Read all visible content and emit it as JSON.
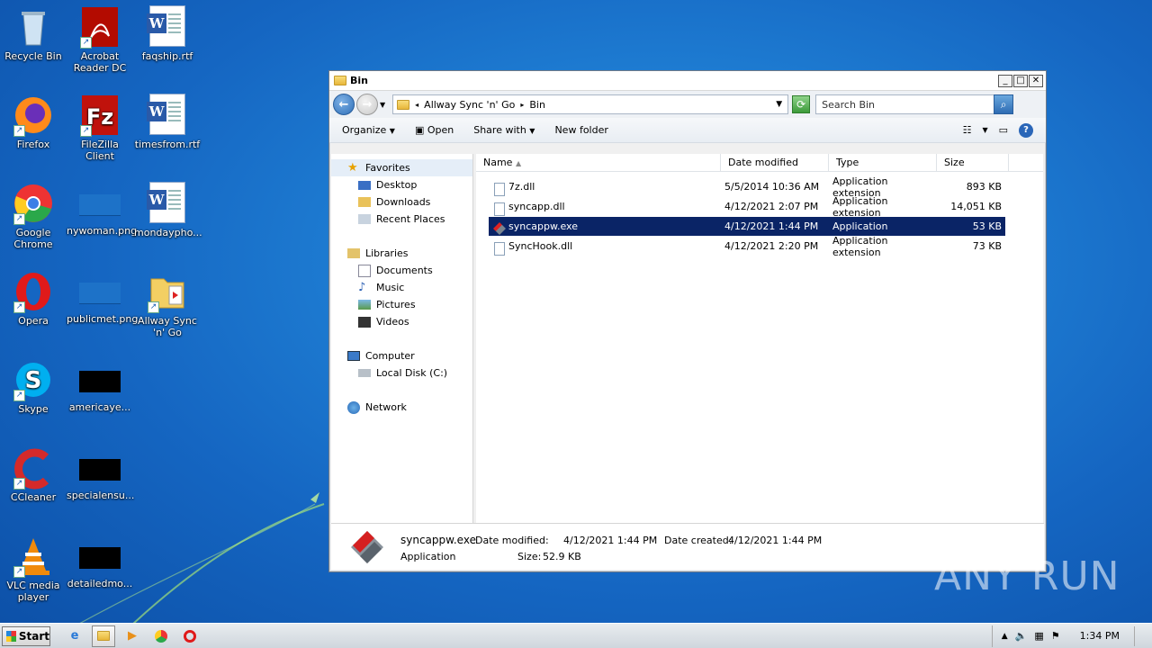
{
  "desktop": {
    "icons": [
      {
        "label": "Recycle Bin",
        "icon": "recycle-bin-icon"
      },
      {
        "label": "Acrobat Reader DC",
        "icon": "acrobat-icon"
      },
      {
        "label": "faqship.rtf",
        "icon": "word-document-icon"
      },
      {
        "label": "Firefox",
        "icon": "firefox-icon"
      },
      {
        "label": "FileZilla Client",
        "icon": "filezilla-icon"
      },
      {
        "label": "timesfrom.rtf",
        "icon": "word-document-icon"
      },
      {
        "label": "Google Chrome",
        "icon": "chrome-icon"
      },
      {
        "label": "nywoman.png",
        "icon": "image-thumbnail"
      },
      {
        "label": "mondaypho...",
        "icon": "word-document-icon"
      },
      {
        "label": "Opera",
        "icon": "opera-icon"
      },
      {
        "label": "publicmet.png",
        "icon": "image-thumbnail"
      },
      {
        "label": "Allway Sync 'n' Go",
        "icon": "allway-sync-icon"
      },
      {
        "label": "Skype",
        "icon": "skype-icon"
      },
      {
        "label": "americaye...",
        "icon": "black-thumbnail"
      },
      {
        "label": "CCleaner",
        "icon": "ccleaner-icon"
      },
      {
        "label": "specialensu...",
        "icon": "black-thumbnail"
      },
      {
        "label": "VLC media player",
        "icon": "vlc-icon"
      },
      {
        "label": "detailedmo...",
        "icon": "black-thumbnail"
      }
    ]
  },
  "window": {
    "title": "Bin",
    "breadcrumb": [
      "Allway Sync 'n' Go",
      "Bin"
    ],
    "search_placeholder": "Search Bin",
    "toolbar": {
      "organize": "Organize",
      "open": "Open",
      "share_with": "Share with",
      "new_folder": "New folder"
    },
    "nav": {
      "favorites": "Favorites",
      "desktop": "Desktop",
      "downloads": "Downloads",
      "recent_places": "Recent Places",
      "libraries": "Libraries",
      "documents": "Documents",
      "music": "Music",
      "pictures": "Pictures",
      "videos": "Videos",
      "computer": "Computer",
      "local_disk": "Local Disk (C:)",
      "network": "Network"
    },
    "columns": {
      "name": "Name",
      "date_modified": "Date modified",
      "type": "Type",
      "size": "Size"
    },
    "files": [
      {
        "name": "7z.dll",
        "date": "5/5/2014 10:36 AM",
        "type": "Application extension",
        "size": "893 KB"
      },
      {
        "name": "syncapp.dll",
        "date": "4/12/2021 2:07 PM",
        "type": "Application extension",
        "size": "14,051 KB"
      },
      {
        "name": "syncappw.exe",
        "date": "4/12/2021 1:44 PM",
        "type": "Application",
        "size": "53 KB"
      },
      {
        "name": "SyncHook.dll",
        "date": "4/12/2021 2:20 PM",
        "type": "Application extension",
        "size": "73 KB"
      }
    ],
    "details": {
      "name": "syncappw.exe",
      "kind": "Application",
      "modified_label": "Date modified:",
      "modified": "4/12/2021 1:44 PM",
      "created_label": "Date created:",
      "created": "4/12/2021 1:44 PM",
      "size_label": "Size:",
      "size": "52.9 KB"
    }
  },
  "taskbar": {
    "start": "Start",
    "clock": "1:34 PM"
  },
  "watermark": "ANY RUN"
}
